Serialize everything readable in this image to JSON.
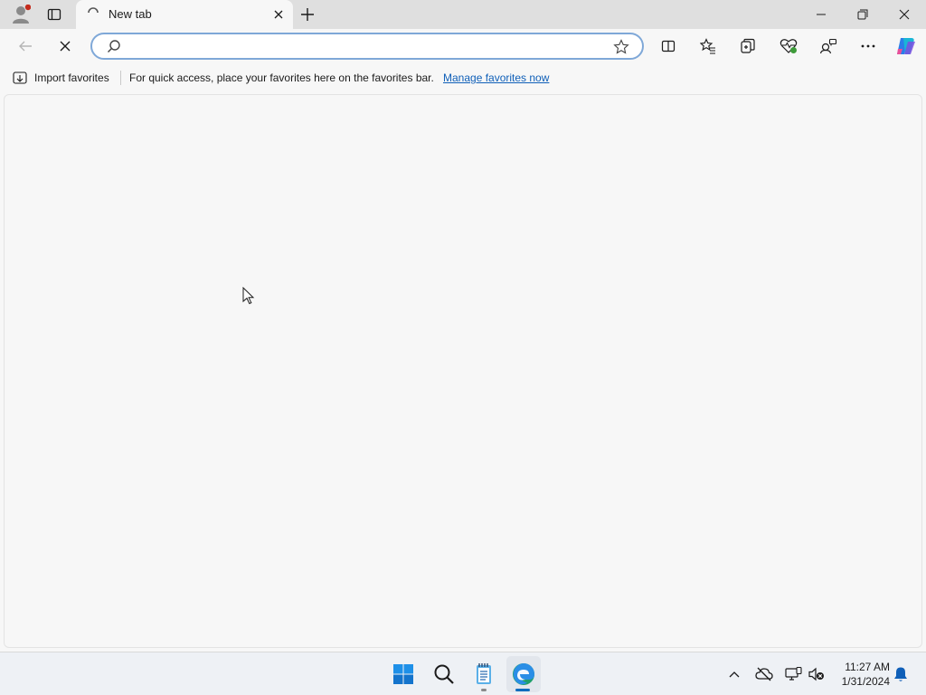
{
  "browser": {
    "tab": {
      "title": "New tab"
    },
    "address": {
      "value": "",
      "placeholder": ""
    }
  },
  "favorites_bar": {
    "import_label": "Import favorites",
    "message": "For quick access, place your favorites here on the favorites bar.",
    "manage_link": "Manage favorites now"
  },
  "taskbar": {
    "time": "11:27 AM",
    "date": "1/31/2024"
  },
  "icons": {
    "profile": "profile-icon",
    "tab_actions": "tab-actions-icon",
    "new_tab": "plus-icon",
    "minimize": "minimize-icon",
    "restore": "restore-icon",
    "close": "close-icon",
    "back": "back-arrow-icon",
    "stop": "stop-icon",
    "search": "search-icon",
    "favorite": "star-icon",
    "split": "split-screen-icon",
    "favorites": "favorites-icon",
    "collections": "collections-icon",
    "performance": "heart-icon",
    "extensions": "extensions-icon",
    "more": "more-icon",
    "copilot": "copilot-icon",
    "start": "windows-start-icon",
    "taskbar_search": "search-icon",
    "notepad": "notepad-icon",
    "edge": "edge-icon",
    "tray_chevron": "chevron-up-icon",
    "onedrive": "cloud-off-icon",
    "network": "network-icon",
    "volume": "volume-muted-icon",
    "notifications": "bell-icon"
  },
  "colors": {
    "accent": "#0f5fb8",
    "notification_dot": "#c42b1c"
  }
}
